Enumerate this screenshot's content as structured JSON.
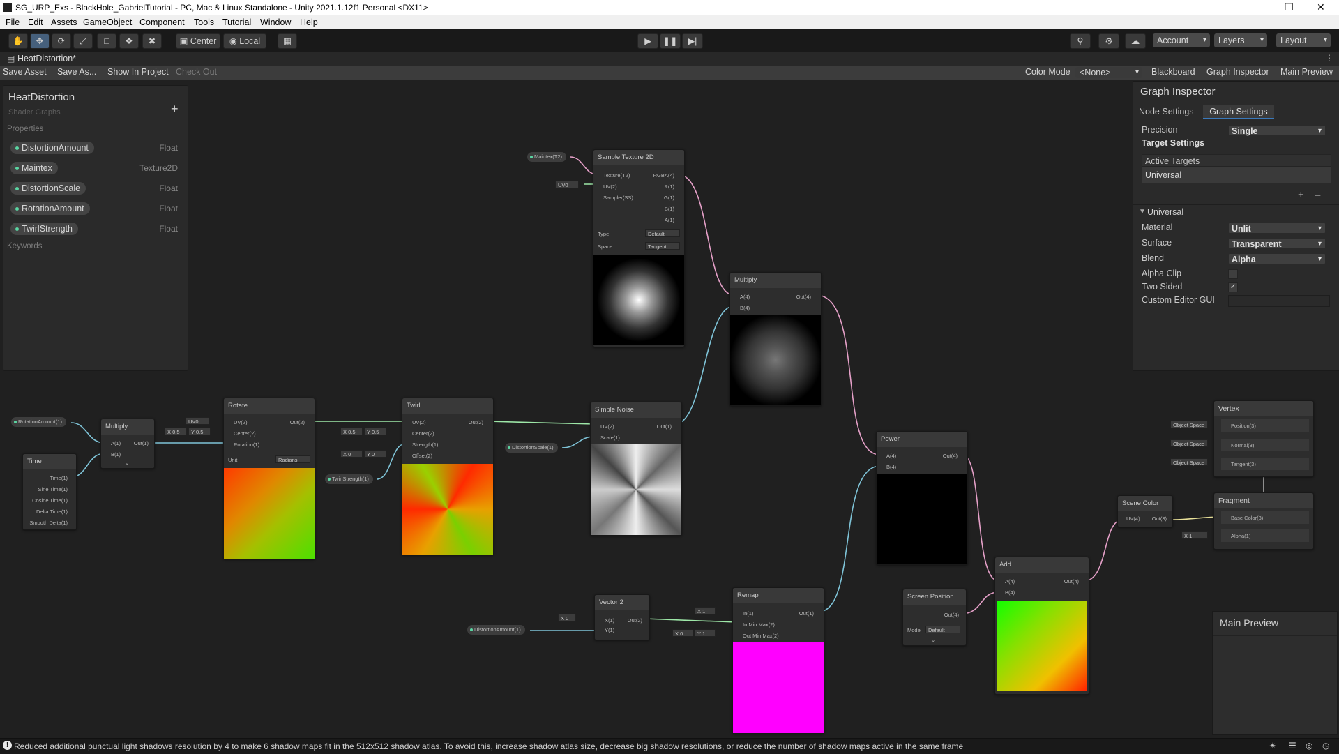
{
  "window": {
    "title": "SG_URP_Exs - BlackHole_GabrielTutorial - PC, Mac & Linux Standalone - Unity 2021.1.12f1 Personal <DX11>"
  },
  "menu": [
    "File",
    "Edit",
    "Assets",
    "GameObject",
    "Component",
    "Tools",
    "Tutorial",
    "Window",
    "Help"
  ],
  "toolbar": {
    "pivot_center": "Center",
    "pivot_local": "Local",
    "account": "Account",
    "layers": "Layers",
    "layout": "Layout"
  },
  "tab": {
    "title": "HeatDistortion*"
  },
  "graph_toolbar": {
    "save_asset": "Save Asset",
    "save_as": "Save As...",
    "show_in_project": "Show In Project",
    "check_out": "Check Out",
    "color_mode_label": "Color Mode",
    "color_mode_value": "<None>",
    "blackboard": "Blackboard",
    "graph_inspector": "Graph Inspector",
    "main_preview": "Main Preview"
  },
  "blackboard": {
    "title": "HeatDistortion",
    "subtitle": "Shader Graphs",
    "properties_label": "Properties",
    "keywords_label": "Keywords",
    "properties": [
      {
        "name": "DistortionAmount",
        "type": "Float"
      },
      {
        "name": "Maintex",
        "type": "Texture2D"
      },
      {
        "name": "DistortionScale",
        "type": "Float"
      },
      {
        "name": "RotationAmount",
        "type": "Float"
      },
      {
        "name": "TwirlStrength",
        "type": "Float"
      }
    ]
  },
  "inspector": {
    "title": "Graph Inspector",
    "tab_node": "Node Settings",
    "tab_graph": "Graph Settings",
    "precision_label": "Precision",
    "precision_value": "Single",
    "target_settings": "Target Settings",
    "active_targets": "Active Targets",
    "target_item": "Universal",
    "universal_header": "Universal",
    "material_label": "Material",
    "material_value": "Unlit",
    "surface_label": "Surface",
    "surface_value": "Transparent",
    "blend_label": "Blend",
    "blend_value": "Alpha",
    "alpha_clip_label": "Alpha Clip",
    "two_sided_label": "Two Sided",
    "custom_editor_label": "Custom Editor GUI",
    "two_sided_check": "✓"
  },
  "nodes": {
    "sample_texture": {
      "title": "Sample Texture 2D",
      "inputs": [
        "Texture(T2)",
        "UV(2)",
        "Sampler(SS)"
      ],
      "outputs": [
        "RGBA(4)",
        "R(1)",
        "G(1)",
        "B(1)",
        "A(1)"
      ],
      "type_label": "Type",
      "type_value": "Default",
      "space_label": "Space",
      "space_value": "Tangent",
      "uv_field": "UV0"
    },
    "maintex_pill": "Maintex(T2)",
    "multiply_top": {
      "title": "Multiply",
      "inputs": [
        "A(4)",
        "B(4)"
      ],
      "output": "Out(4)"
    },
    "rotation_pill": "RotationAmount(1)",
    "multiply_left": {
      "title": "Multiply",
      "inputs": [
        "A(1)",
        "B(1)"
      ],
      "output": "Out(1)"
    },
    "time": {
      "title": "Time",
      "outputs": [
        "Time(1)",
        "Sine Time(1)",
        "Cosine Time(1)",
        "Delta Time(1)",
        "Smooth Delta(1)"
      ]
    },
    "rotate": {
      "title": "Rotate",
      "inputs": [
        "UV(2)",
        "Center(2)",
        "Rotation(1)"
      ],
      "output": "Out(2)",
      "unit_label": "Unit",
      "unit_value": "Radians",
      "uv_field": "UV0",
      "cx": "X",
      "cx_val": "0.5",
      "cy": "Y",
      "cy_val": "0.5"
    },
    "twirl": {
      "title": "Twirl",
      "inputs": [
        "UV(2)",
        "Center(2)",
        "Strength(1)",
        "Offset(2)"
      ],
      "output": "Out(2)",
      "cx": "X",
      "cx_val": "0.5",
      "cy": "Y",
      "cy_val": "0.5",
      "ox": "X",
      "ox_val": "0",
      "oy": "Y",
      "oy_val": "0"
    },
    "twirl_pill": "TwirlStrength(1)",
    "simple_noise": {
      "title": "Simple Noise",
      "inputs": [
        "UV(2)",
        "Scale(1)"
      ],
      "output": "Out(1)"
    },
    "distortion_scale_pill": "DistortionScale(1)",
    "power": {
      "title": "Power",
      "inputs": [
        "A(4)",
        "B(4)"
      ],
      "output": "Out(4)"
    },
    "vector2": {
      "title": "Vector 2",
      "inputs": [
        "X(1)",
        "Y(1)"
      ],
      "output": "Out(2)",
      "x_label": "X",
      "x_val": "0"
    },
    "distortion_amount_pill": "DistortionAmount(1)",
    "remap": {
      "title": "Remap",
      "inputs": [
        "In(1)",
        "In Min Max(2)",
        "Out Min Max(2)"
      ],
      "output": "Out(1)",
      "in_x": "X",
      "in_x_val": "1",
      "out_x": "X",
      "out_x_val": "0",
      "out_y": "Y",
      "out_y_val": "1"
    },
    "screen_position": {
      "title": "Screen Position",
      "output": "Out(4)",
      "mode_label": "Mode",
      "mode_value": "Default"
    },
    "add": {
      "title": "Add",
      "inputs": [
        "A(4)",
        "B(4)"
      ],
      "output": "Out(4)"
    },
    "scene_color": {
      "title": "Scene Color",
      "input": "UV(4)",
      "output": "Out(3)"
    },
    "vertex": {
      "title": "Vertex",
      "ports": [
        "Position(3)",
        "Normal(3)",
        "Tangent(3)"
      ],
      "space": "Object Space"
    },
    "fragment": {
      "title": "Fragment",
      "ports": [
        "Base Color(3)",
        "Alpha(1)"
      ],
      "alpha_x": "X",
      "alpha_val": "1"
    }
  },
  "main_preview": {
    "title": "Main Preview"
  },
  "status": {
    "message": "Reduced additional punctual light shadows resolution by 4 to make 6 shadow maps fit in the 512x512 shadow atlas. To avoid this, increase shadow atlas size, decrease big shadow resolutions, or reduce the number of shadow maps active in the same frame"
  }
}
